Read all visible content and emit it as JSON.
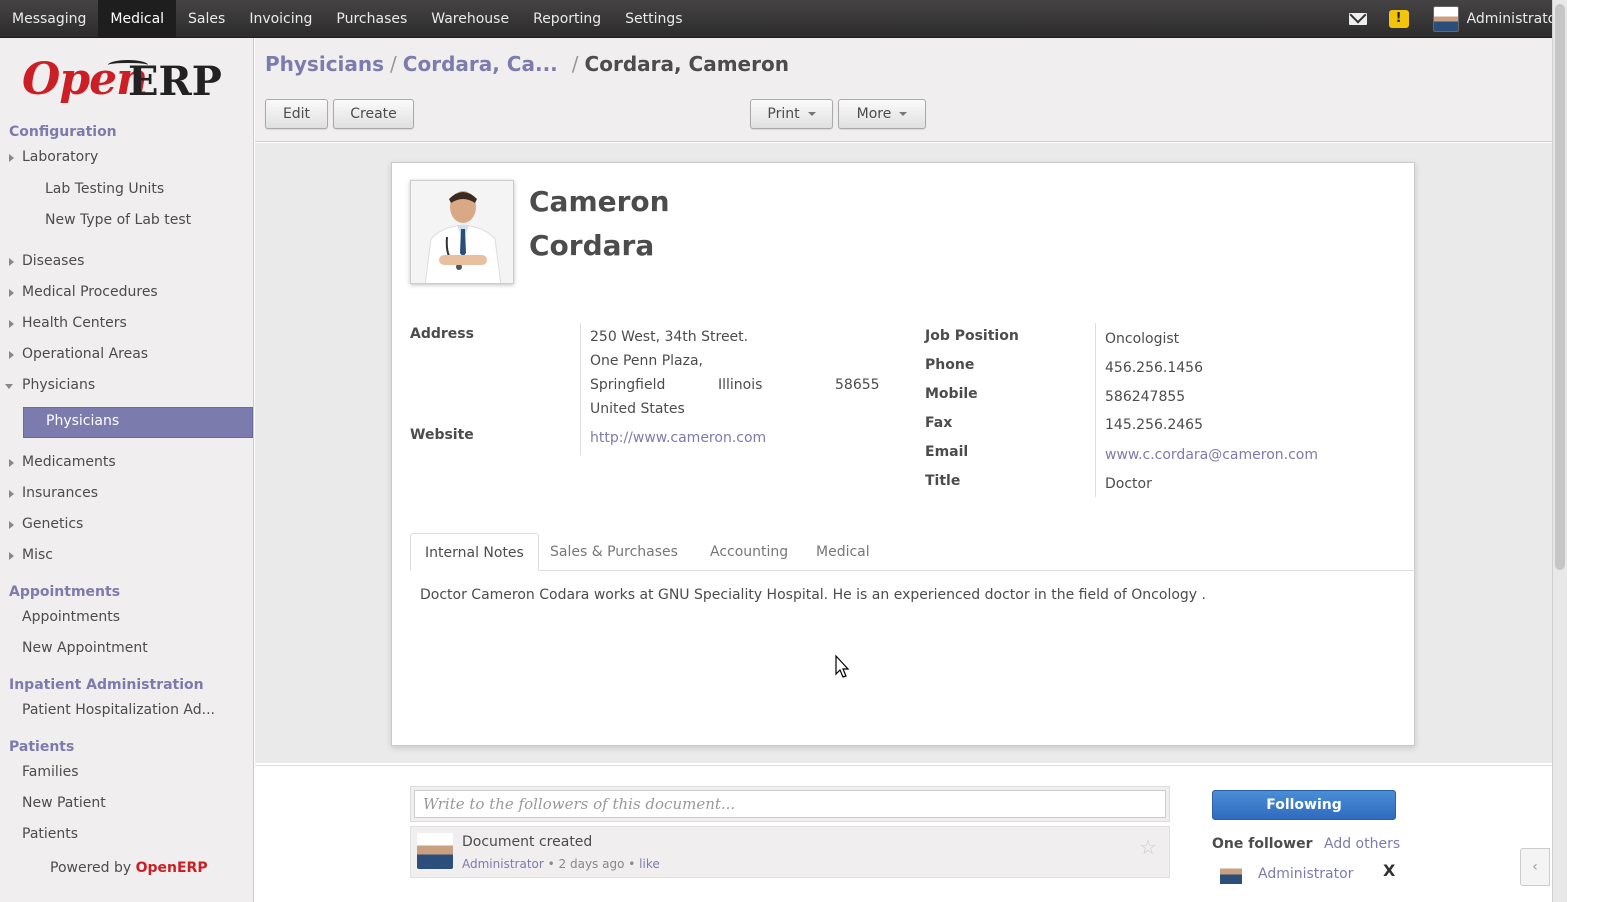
{
  "topbar": {
    "menu": [
      "Messaging",
      "Medical",
      "Sales",
      "Invoicing",
      "Purchases",
      "Warehouse",
      "Reporting",
      "Settings"
    ],
    "active": "Medical",
    "warning_badge": "!",
    "user": "Administrator"
  },
  "logo": {
    "open": "Open",
    "erp": "ERP"
  },
  "sidebar": {
    "configuration": "Configuration",
    "laboratory": "Laboratory",
    "lab_testing_units": "Lab Testing Units",
    "new_type_lab_test": "New Type of Lab test",
    "diseases": "Diseases",
    "medical_procedures": "Medical Procedures",
    "health_centers": "Health Centers",
    "operational_areas": "Operational Areas",
    "physicians_group": "Physicians",
    "physicians_active": "Physicians",
    "medicaments": "Medicaments",
    "insurances": "Insurances",
    "genetics": "Genetics",
    "misc": "Misc",
    "appointments_section": "Appointments",
    "appointments": "Appointments",
    "new_appointment": "New Appointment",
    "inpatient_section": "Inpatient Administration",
    "patient_hosp": "Patient Hospitalization Ad...",
    "patients_section": "Patients",
    "families": "Families",
    "new_patient": "New Patient",
    "patients": "Patients",
    "powered_by": "Powered by",
    "powered_brand": "OpenERP"
  },
  "breadcrumb": {
    "first": "Physicians",
    "second": "Cordara, Ca...",
    "current": "Cordara, Cameron"
  },
  "buttons": {
    "edit": "Edit",
    "create": "Create",
    "print": "Print",
    "more": "More"
  },
  "record": {
    "first_name": "Cameron",
    "last_name": "Cordara",
    "address_label": "Address",
    "street": "250 West, 34th Street.",
    "street2": "One Penn Plaza,",
    "city": "Springfield",
    "state": "Illinois",
    "zip": "58655",
    "country": "United States",
    "website_label": "Website",
    "website": "http://www.cameron.com",
    "job_label": "Job Position",
    "job": "Oncologist",
    "phone_label": "Phone",
    "phone": "456.256.1456",
    "mobile_label": "Mobile",
    "mobile": "586247855",
    "fax_label": "Fax",
    "fax": "145.256.2465",
    "email_label": "Email",
    "email": "www.c.cordara@cameron.com",
    "title_label": "Title",
    "title": "Doctor"
  },
  "tabs": [
    "Internal Notes",
    "Sales & Purchases",
    "Accounting",
    "Medical"
  ],
  "notes": "Doctor Cameron Codara works at GNU Speciality Hospital. He is an experienced doctor in the field of Oncology .",
  "chatter": {
    "placeholder": "Write to the followers of this document...",
    "message_title": "Document created",
    "message_author": "Administrator",
    "message_time": "2 days ago",
    "message_like": "like",
    "following": "Following",
    "followers_count": "One follower",
    "add_others": "Add others",
    "follower_name": "Administrator",
    "remove": "X"
  },
  "colors": {
    "accent": "#7c7bad",
    "brand": "#cc1f25",
    "following": "#2f6bbf"
  }
}
